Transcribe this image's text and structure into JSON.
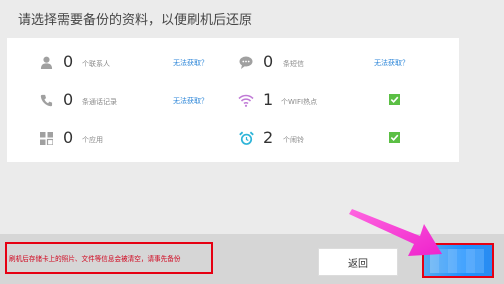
{
  "header": {
    "title": "请选择需要备份的资料，以便刷机后还原"
  },
  "items": {
    "contacts": {
      "count": "0",
      "label": "个联系人",
      "action": "无法获取？",
      "icon": "person-icon"
    },
    "sms": {
      "count": "0",
      "label": "条短信",
      "action": "无法获取？",
      "icon": "chat-bubble-icon"
    },
    "calls": {
      "count": "0",
      "label": "条通话记录",
      "action": "无法获取？",
      "icon": "phone-icon"
    },
    "wifi": {
      "count": "1",
      "label": "个WIFI热点",
      "checked": true,
      "icon": "wifi-icon"
    },
    "apps": {
      "count": "0",
      "label": "个应用",
      "icon": "apps-grid-icon"
    },
    "alarms": {
      "count": "2",
      "label": "个闹铃",
      "checked": true,
      "icon": "alarm-clock-icon"
    }
  },
  "footer": {
    "warning": "刷机后存储卡上的照片、文件等信息会被清空，请事先备份",
    "back_label": "返回"
  },
  "colors": {
    "accent": "#2c86d8",
    "check": "#5bbf44",
    "warning": "#e60012",
    "arrow": "#ff33cc",
    "next_button": "#1e90ff"
  }
}
